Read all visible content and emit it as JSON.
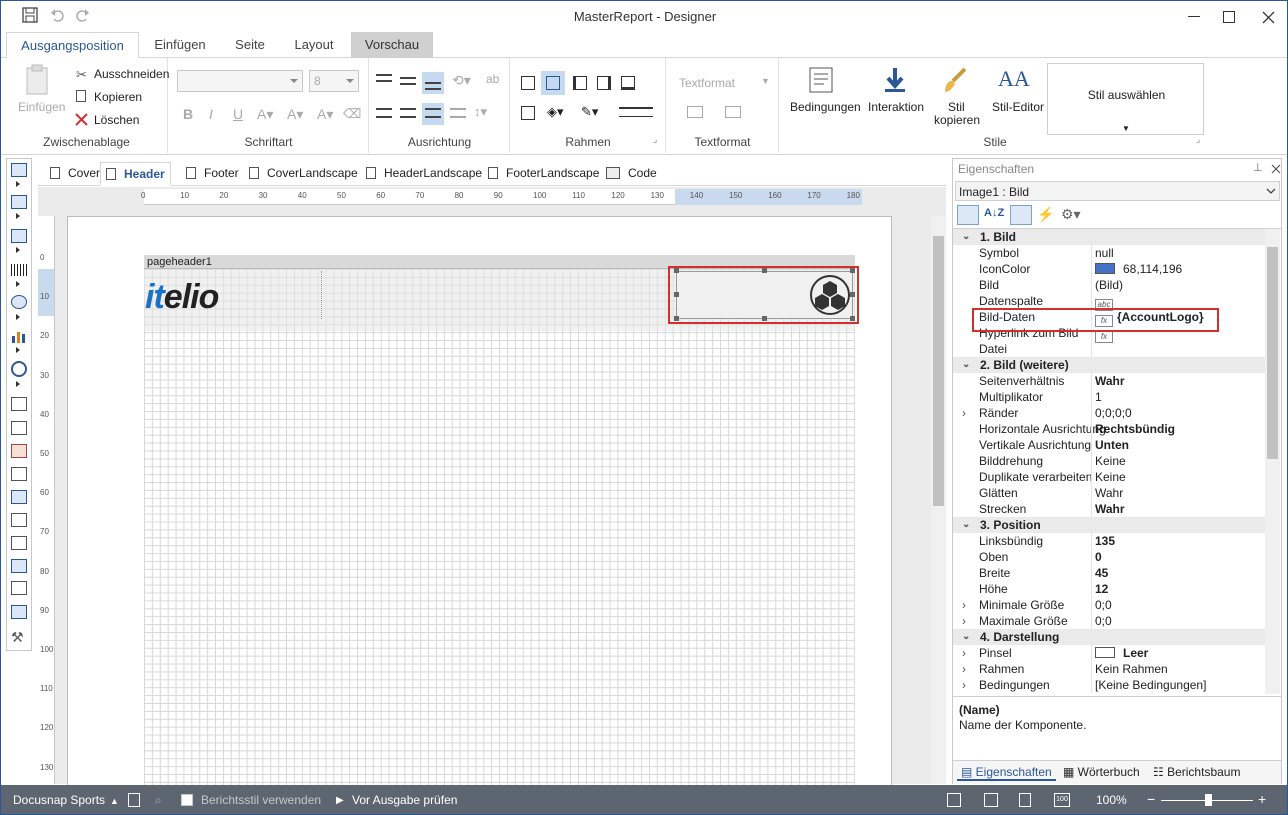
{
  "window": {
    "title": "MasterReport - Designer"
  },
  "ribbon_tabs": [
    "Ausgangsposition",
    "Einfügen",
    "Seite",
    "Layout",
    "Vorschau"
  ],
  "clipboard": {
    "paste": "Einfügen",
    "cut": "Ausschneiden",
    "copy": "Kopieren",
    "delete": "Löschen",
    "group": "Zwischenablage"
  },
  "font": {
    "size": "8",
    "bold": "B",
    "italic": "I",
    "underline": "U",
    "group": "Schriftart"
  },
  "alignment": {
    "group": "Ausrichtung"
  },
  "borders": {
    "group": "Rahmen"
  },
  "textformat": {
    "combo": "Textformat",
    "group": "Textformat"
  },
  "styles": {
    "conditions": "Bedingungen",
    "interaction": "Interaktion",
    "copy_style_1": "Stil",
    "copy_style_2": "kopieren",
    "style_editor": "Stil-Editor",
    "select_style": "Stil auswählen",
    "group": "Stile"
  },
  "doc_tabs": [
    "Cover",
    "Header",
    "Footer",
    "CoverLandscape",
    "HeaderLandscape",
    "FooterLandscape",
    "Code"
  ],
  "ruler_h": [
    "0",
    "10",
    "20",
    "30",
    "40",
    "50",
    "60",
    "70",
    "80",
    "90",
    "100",
    "110",
    "120",
    "130",
    "140",
    "150",
    "160",
    "170",
    "180"
  ],
  "ruler_v": [
    "0",
    "10",
    "20",
    "30",
    "40",
    "50",
    "60",
    "70",
    "80",
    "90",
    "100",
    "110",
    "120",
    "130"
  ],
  "band_label": "pageheader1",
  "logo": {
    "accent": "it",
    "rest": "elio",
    "accent_color": "#1a73c7"
  },
  "properties": {
    "header": "Eigenschaften",
    "object": "Image1 : Bild",
    "rows": [
      {
        "type": "cat",
        "key": "1. Bild"
      },
      {
        "key": "Symbol",
        "value": "null"
      },
      {
        "key": "IconColor",
        "value": "68,114,196",
        "swatch": "#4472c4"
      },
      {
        "key": "Bild",
        "value": "(Bild)"
      },
      {
        "key": "Datenspalte",
        "value": "",
        "icon": "abc"
      },
      {
        "key": "Bild-Daten",
        "value": "{AccountLogo}",
        "icon": "fx",
        "bold": true
      },
      {
        "key": "Hyperlink zum Bild",
        "value": "",
        "icon": "fx"
      },
      {
        "key": "Datei",
        "value": ""
      },
      {
        "type": "cat",
        "key": "2. Bild (weitere)"
      },
      {
        "key": "Seitenverhältnis",
        "value": "Wahr",
        "bold": true
      },
      {
        "key": "Multiplikator",
        "value": "1"
      },
      {
        "key": "Ränder",
        "value": "0;0;0;0",
        "expand": true
      },
      {
        "key": "Horizontale Ausrichtung",
        "value": "Rechtsbündig",
        "bold": true
      },
      {
        "key": "Vertikale Ausrichtung",
        "value": "Unten",
        "bold": true
      },
      {
        "key": "Bilddrehung",
        "value": "Keine"
      },
      {
        "key": "Duplikate verarbeiten",
        "value": "Keine"
      },
      {
        "key": "Glätten",
        "value": "Wahr"
      },
      {
        "key": "Strecken",
        "value": "Wahr",
        "bold": true
      },
      {
        "type": "cat",
        "key": "3. Position"
      },
      {
        "key": "Linksbündig",
        "value": "135",
        "bold": true
      },
      {
        "key": "Oben",
        "value": "0",
        "bold": true
      },
      {
        "key": "Breite",
        "value": "45",
        "bold": true
      },
      {
        "key": "Höhe",
        "value": "12",
        "bold": true
      },
      {
        "key": "Minimale Größe",
        "value": "0;0",
        "expand": true
      },
      {
        "key": "Maximale Größe",
        "value": "0;0",
        "expand": true
      },
      {
        "type": "cat",
        "key": "4. Darstellung"
      },
      {
        "key": "Pinsel",
        "value": "Leer",
        "expand": true,
        "bold": true,
        "swatch": "#ffffff"
      },
      {
        "key": "Rahmen",
        "value": "Kein Rahmen",
        "expand": true
      },
      {
        "key": "Bedingungen",
        "value": "[Keine Bedingungen]",
        "expand": true
      }
    ],
    "desc_title": "(Name)",
    "desc_text": "Name der Komponente.",
    "bottom_tabs": [
      "Eigenschaften",
      "Wörterbuch",
      "Berichtsbaum"
    ]
  },
  "status": {
    "report": "Docusnap Sports",
    "report_style": "Berichtsstil verwenden",
    "check": "Vor Ausgabe prüfen",
    "zoom": "100%"
  }
}
